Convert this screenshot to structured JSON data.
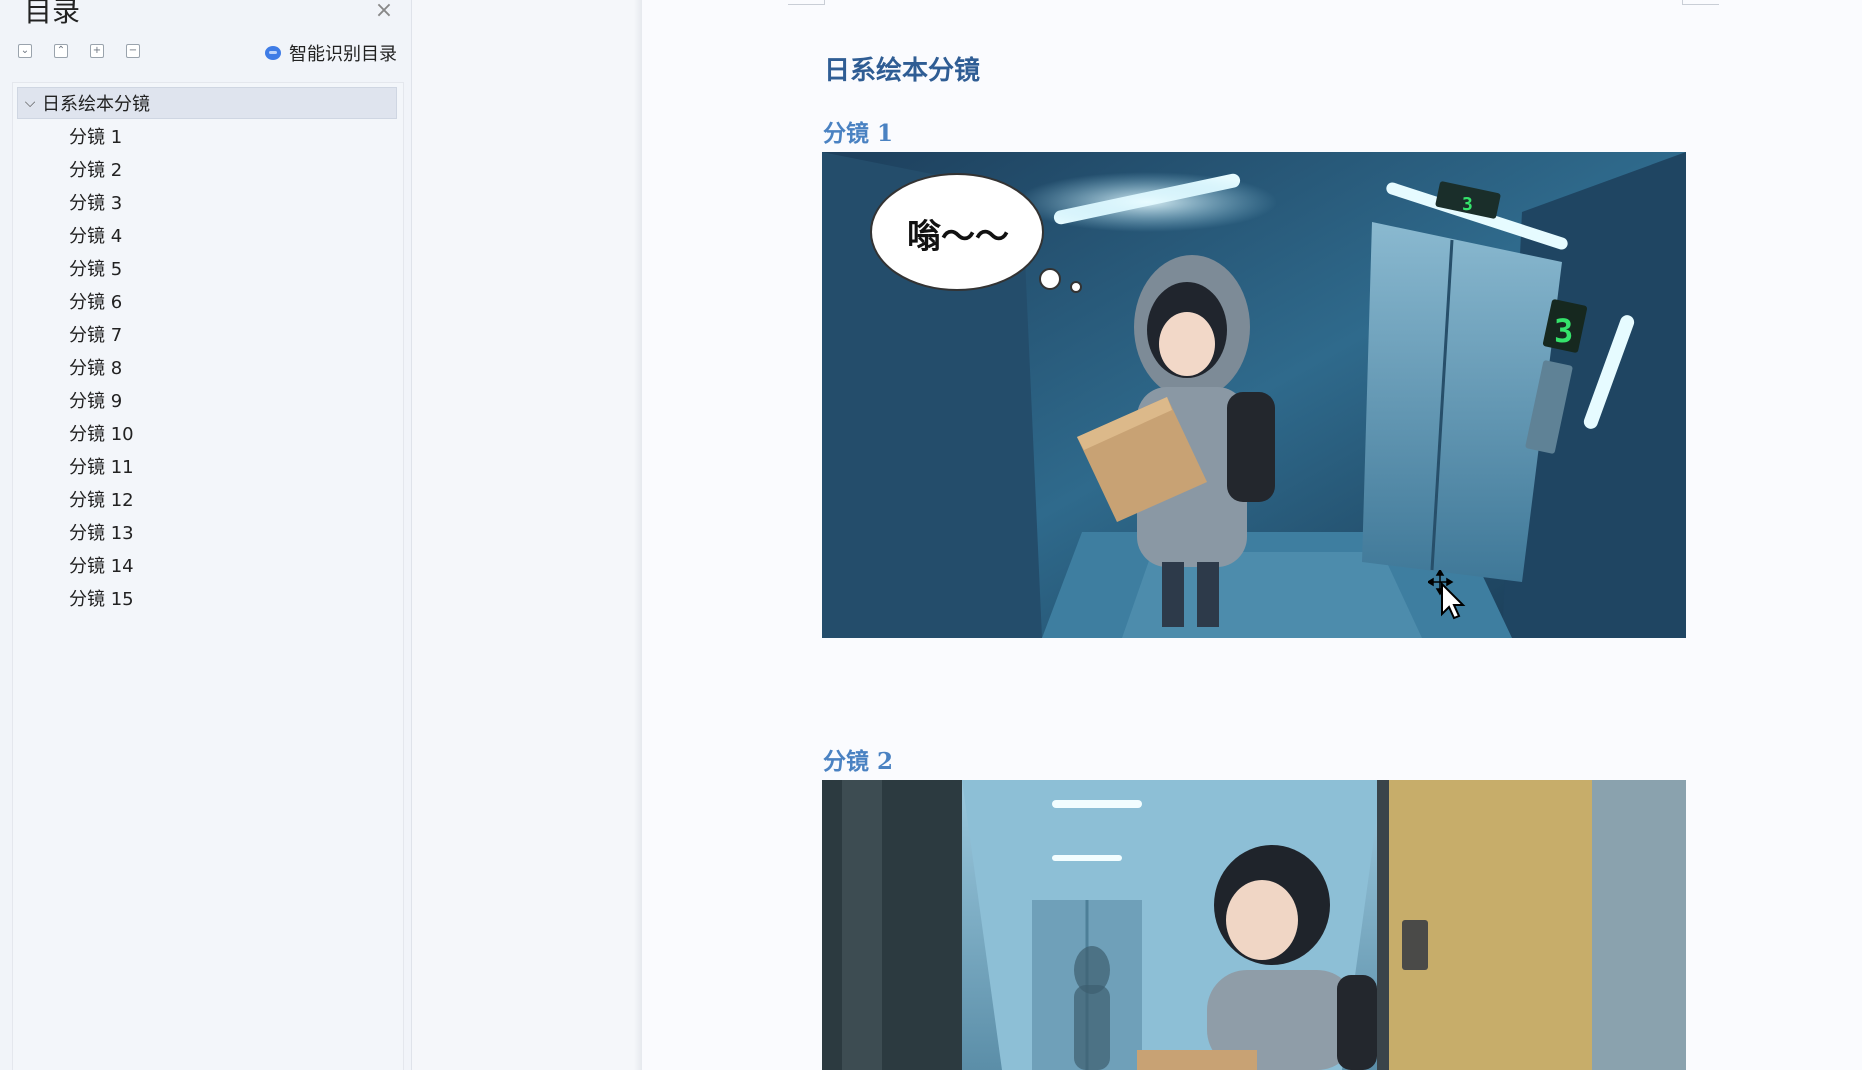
{
  "nav": {
    "title": "目录",
    "close_icon": "close-icon",
    "tools": [
      {
        "icon": "collapse-all-icon",
        "glyph": "⌄"
      },
      {
        "icon": "expand-all-icon",
        "glyph": "⌃"
      },
      {
        "icon": "add-heading-icon",
        "glyph": "+"
      },
      {
        "icon": "remove-heading-icon",
        "glyph": "−"
      }
    ],
    "smart_toc_label": "智能识别目录",
    "root": {
      "label": "日系绘本分镜",
      "expanded": true
    },
    "items": [
      "分镜 1",
      "分镜 2",
      "分镜 3",
      "分镜 4",
      "分镜 5",
      "分镜 6",
      "分镜 7",
      "分镜 8",
      "分镜 9",
      "分镜 10",
      "分镜 11",
      "分镜 12",
      "分镜 13",
      "分镜 14",
      "分镜 15"
    ]
  },
  "document": {
    "title": "日系绘本分镜",
    "sections": [
      {
        "heading": "分镜 1",
        "speech_bubble": "嗡～～",
        "floor_display": "3"
      },
      {
        "heading": "分镜 2"
      }
    ]
  },
  "colors": {
    "title": "#2f5d94",
    "heading": "#4a82c2",
    "accent": "#3f7ce6"
  }
}
